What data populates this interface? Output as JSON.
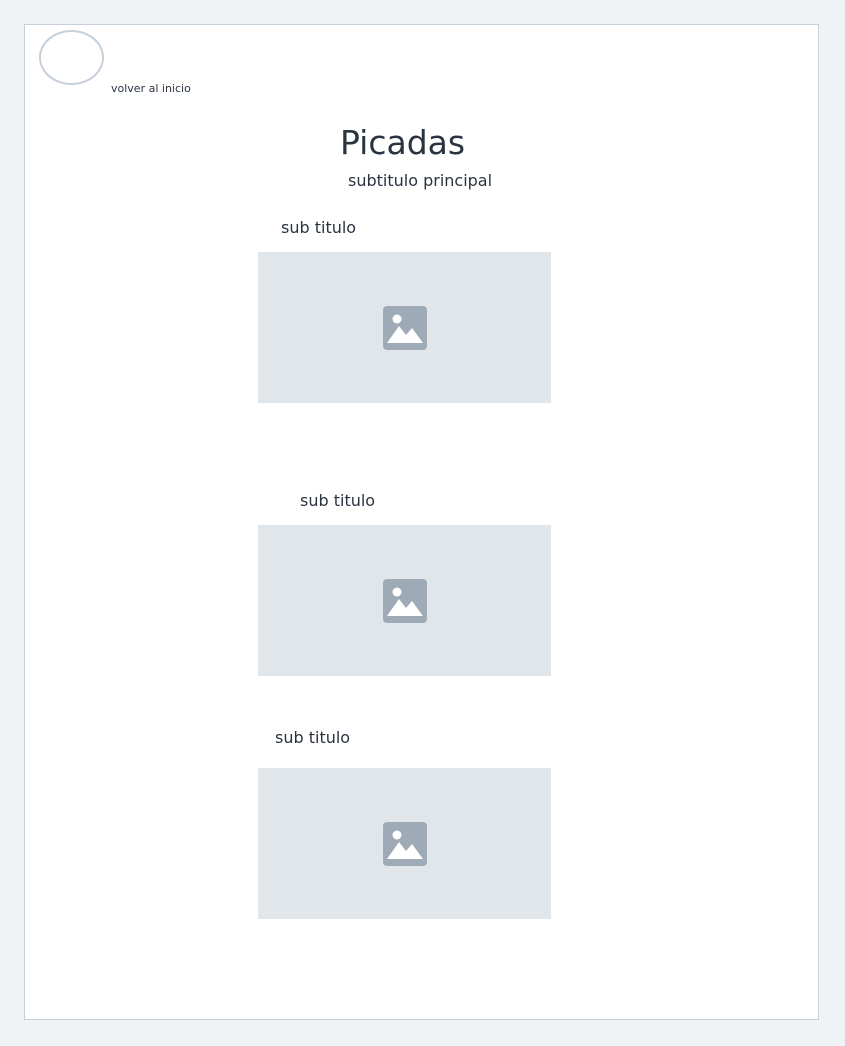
{
  "header": {
    "logo_icon": "circle-placeholder-icon",
    "home_link_label": "volver al inicio"
  },
  "page": {
    "title": "Picadas",
    "subtitle": "subtitulo principal"
  },
  "sections": [
    {
      "subtitle": "sub titulo",
      "image_icon": "image-placeholder-icon"
    },
    {
      "subtitle": "sub titulo",
      "image_icon": "image-placeholder-icon"
    },
    {
      "subtitle": "sub titulo",
      "image_icon": "image-placeholder-icon"
    }
  ],
  "colors": {
    "page_background": "#eff3f6",
    "frame_border": "#c5d0da",
    "placeholder_background": "#e1e6ea",
    "placeholder_icon": "#9eaab5",
    "text": "#2a3440"
  }
}
